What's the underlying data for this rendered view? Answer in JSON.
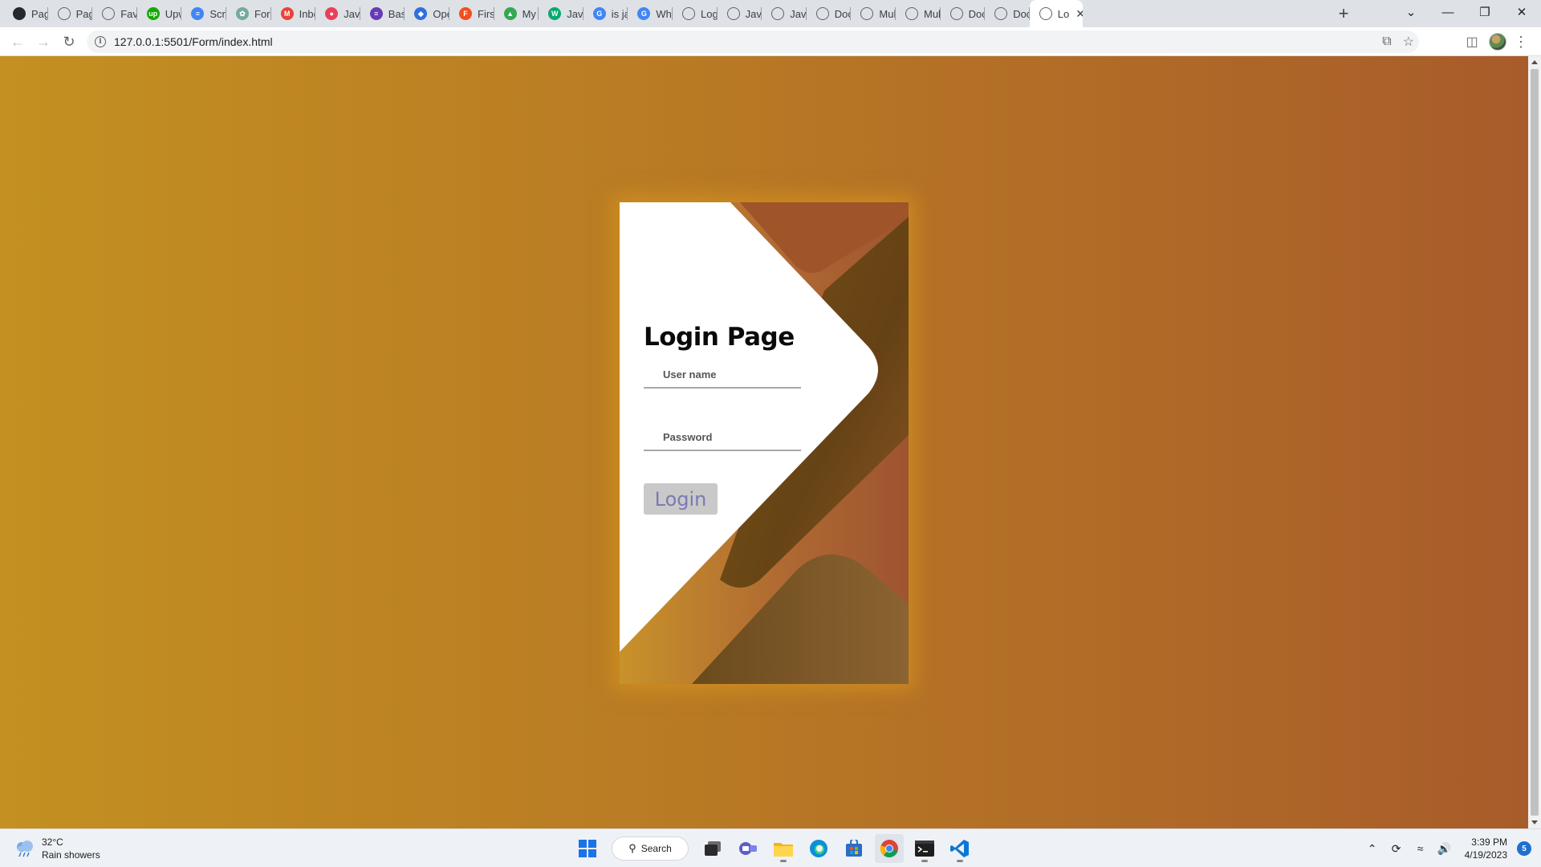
{
  "browser": {
    "tabs": [
      {
        "label": "Pages",
        "icon": "github-icon",
        "color": "#24292f"
      },
      {
        "label": "Page",
        "icon": "globe-icon",
        "color": "#5f6368"
      },
      {
        "label": "Favip",
        "icon": "globe-icon",
        "color": "#5f6368"
      },
      {
        "label": "Upwo",
        "icon": "upwork-icon",
        "color": "#14a800"
      },
      {
        "label": "Scree",
        "icon": "google-docs-icon",
        "color": "#4285f4"
      },
      {
        "label": "For lo",
        "icon": "chatgpt-icon",
        "color": "#74aa9c"
      },
      {
        "label": "Inbox",
        "icon": "gmail-icon",
        "color": "#ea4335"
      },
      {
        "label": "JavaS",
        "icon": "javascript-site-icon",
        "color": "#e8405a"
      },
      {
        "label": "Basic",
        "icon": "forms-icon",
        "color": "#673ab7"
      },
      {
        "label": "Open",
        "icon": "openai-icon",
        "color": "#2f6fe0"
      },
      {
        "label": "First",
        "icon": "figma-icon",
        "color": "#f24e1e"
      },
      {
        "label": "My D",
        "icon": "google-drive-icon",
        "color": "#34a853"
      },
      {
        "label": "Java",
        "icon": "w3schools-icon",
        "color": "#04aa6d"
      },
      {
        "label": "is jav",
        "icon": "google-icon",
        "color": "#4285f4"
      },
      {
        "label": "What",
        "icon": "google-icon",
        "color": "#4285f4"
      },
      {
        "label": "Login",
        "icon": "globe-icon",
        "color": "#5f6368"
      },
      {
        "label": "Javas",
        "icon": "globe-icon",
        "color": "#5f6368"
      },
      {
        "label": "Javas",
        "icon": "globe-icon",
        "color": "#5f6368"
      },
      {
        "label": "Docu",
        "icon": "globe-icon",
        "color": "#5f6368"
      },
      {
        "label": "Multi",
        "icon": "globe-icon",
        "color": "#5f6368"
      },
      {
        "label": "Multi",
        "icon": "globe-icon",
        "color": "#5f6368"
      },
      {
        "label": "Docu",
        "icon": "globe-icon",
        "color": "#5f6368"
      },
      {
        "label": "Docu",
        "icon": "globe-icon",
        "color": "#5f6368"
      }
    ],
    "active_tab": {
      "label": "Lo",
      "icon": "globe-icon"
    },
    "url": "127.0.0.1:5501/Form/index.html"
  },
  "page": {
    "title": "Login Page",
    "username_placeholder": "User name",
    "password_placeholder": "Password",
    "login_button": "Login",
    "colors": {
      "background_start": "#c39021",
      "background_end": "#a85c2a",
      "card_shape": "#ffffff",
      "button_bg": "#c9c9c9",
      "button_text": "#7a7ab2"
    }
  },
  "taskbar": {
    "weather_temp": "32°C",
    "weather_desc": "Rain showers",
    "search_label": "Search",
    "apps": [
      "windows-start-icon",
      "task-view-icon",
      "teams-icon",
      "file-explorer-icon",
      "edge-icon",
      "store-icon",
      "chrome-icon",
      "terminal-icon",
      "vscode-icon"
    ],
    "time": "3:39 PM",
    "date": "4/19/2023",
    "notification_count": "5"
  }
}
